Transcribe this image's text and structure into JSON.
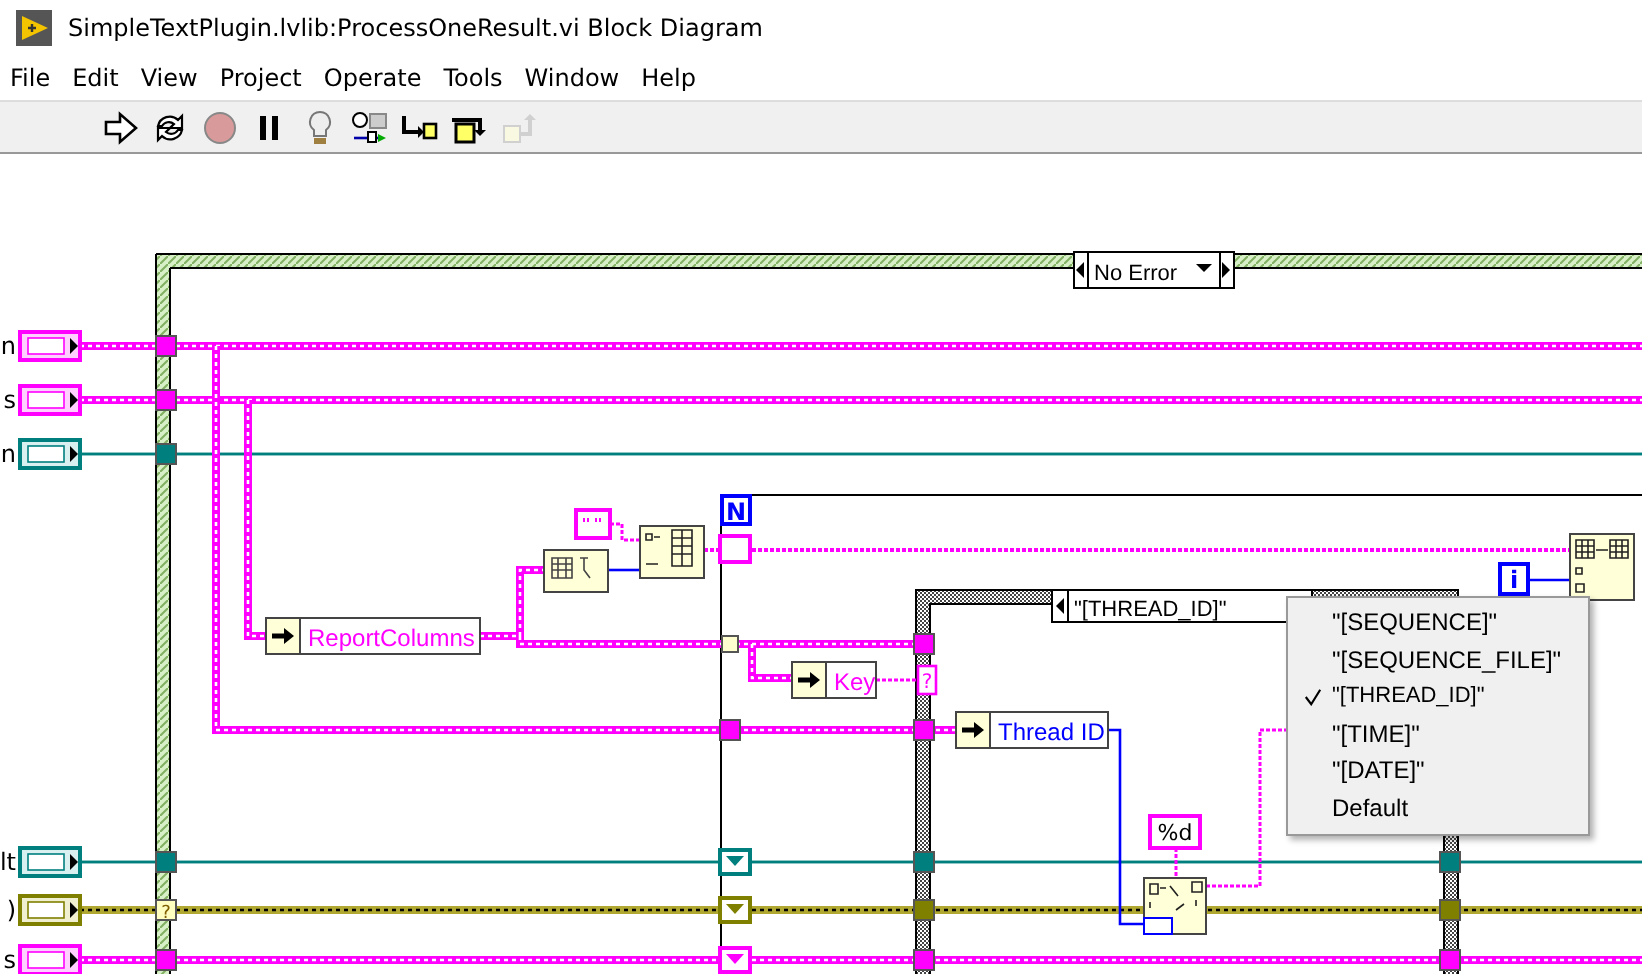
{
  "window": {
    "title": "SimpleTextPlugin.lvlib:ProcessOneResult.vi Block Diagram"
  },
  "menu": [
    "File",
    "Edit",
    "View",
    "Project",
    "Operate",
    "Tools",
    "Window",
    "Help"
  ],
  "toolbar": [
    {
      "kind": "run",
      "disabled": false
    },
    {
      "kind": "run-continuously",
      "disabled": false
    },
    {
      "kind": "abort",
      "disabled": false
    },
    {
      "kind": "pause",
      "disabled": false
    },
    {
      "kind": "highlight",
      "disabled": false
    },
    {
      "kind": "probe",
      "disabled": false
    },
    {
      "kind": "step-into",
      "disabled": false
    },
    {
      "kind": "step-over",
      "disabled": false
    },
    {
      "kind": "step-out",
      "disabled": true
    }
  ],
  "terminals": [
    {
      "label": "n",
      "kind": "cluster"
    },
    {
      "label": "s",
      "kind": "cluster"
    },
    {
      "label": "n",
      "kind": "refnum"
    },
    {
      "label": "lt",
      "kind": "refnum"
    },
    {
      "label": ")",
      "kind": "error",
      "tunnel_mark": "?"
    },
    {
      "label": "s",
      "kind": "cluster"
    }
  ],
  "case_structure": {
    "selector": "No Error"
  },
  "for_loop": {
    "count_label": "N",
    "index_label": "i"
  },
  "nodes": [
    {
      "label": "ReportColumns"
    },
    {
      "label": "Key",
      "tunnel_mark": "?"
    },
    {
      "label": "Thread ID"
    }
  ],
  "format_string": "%d",
  "inner_case": {
    "selector": "\"[THREAD_ID]\""
  },
  "dropdown": [
    {
      "label": "\"[SEQUENCE]\"",
      "selected": false
    },
    {
      "label": "\"[SEQUENCE_FILE]\"",
      "selected": false
    },
    {
      "label": "\"[THREAD_ID]\"",
      "selected": true
    },
    {
      "label": "\"[TIME]\"",
      "selected": false
    },
    {
      "label": "\"[DATE]\"",
      "selected": false
    },
    {
      "label": "Default",
      "selected": false
    }
  ]
}
